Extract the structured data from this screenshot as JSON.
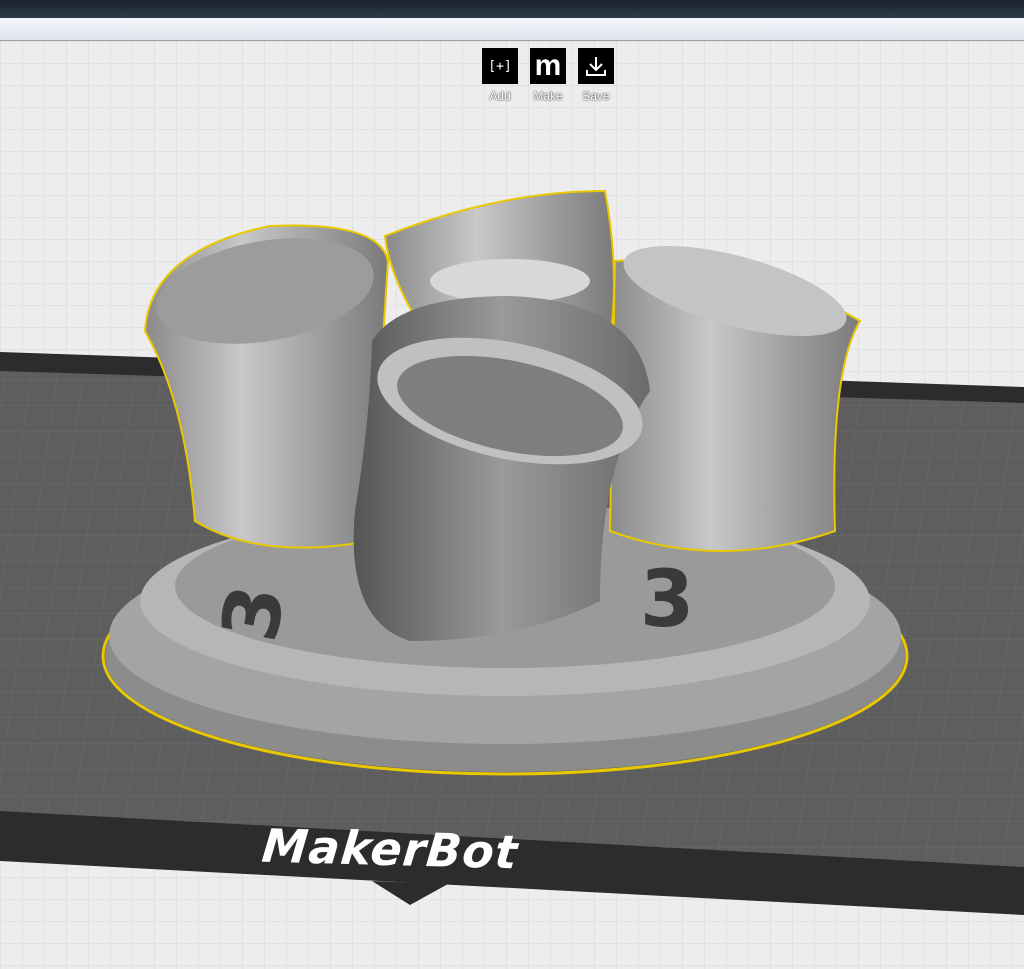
{
  "toolbar": {
    "items": [
      {
        "label": "Add",
        "icon": "add-icon",
        "glyph": "[+]"
      },
      {
        "label": "Make",
        "icon": "makerbot-m-icon",
        "glyph": "m"
      },
      {
        "label": "Save",
        "icon": "download-icon"
      }
    ]
  },
  "platform": {
    "brand": "MakerBot"
  },
  "model": {
    "engraving_left": "3",
    "engraving_right": "3"
  },
  "colors": {
    "selection_outline": "#e8c800",
    "platform": "#5a5a5a",
    "model": "#b4b4b4"
  }
}
